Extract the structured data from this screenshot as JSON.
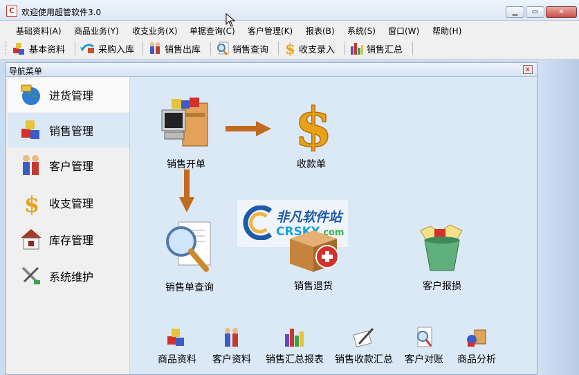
{
  "window": {
    "app_icon_letter": "C",
    "title": "欢迎使用超管软件3.0",
    "controls": [
      "minimize",
      "maximize",
      "close"
    ]
  },
  "menubar": {
    "items": [
      "基础资料(A)",
      "商品业务(Y)",
      "收支业务(X)",
      "单据查询(C)",
      "客户管理(K)",
      "报表(B)",
      "系统(S)",
      "窗口(W)",
      "帮助(H)"
    ]
  },
  "toolbar": {
    "buttons": [
      {
        "label": "基本资料",
        "icon": "blocks-icon"
      },
      {
        "label": "采购入库",
        "icon": "purchase-icon"
      },
      {
        "label": "销售出库",
        "icon": "people-icon"
      },
      {
        "label": "销售查询",
        "icon": "magnifier-doc-icon"
      },
      {
        "label": "收支录入",
        "icon": "dollar-icon"
      },
      {
        "label": "销售汇总",
        "icon": "bar-chart-icon"
      }
    ]
  },
  "panel": {
    "title": "导航菜单",
    "close_label": "x"
  },
  "nav": {
    "items": [
      {
        "label": "进货管理",
        "icon": "globe-icon",
        "state": "hover"
      },
      {
        "label": "销售管理",
        "icon": "blocks-icon",
        "state": "active"
      },
      {
        "label": "客户管理",
        "icon": "people-icon",
        "state": ""
      },
      {
        "label": "收支管理",
        "icon": "dollar-icon",
        "state": ""
      },
      {
        "label": "库存管理",
        "icon": "house-icon",
        "state": ""
      },
      {
        "label": "系统维护",
        "icon": "tools-icon",
        "state": ""
      }
    ]
  },
  "content": {
    "big_items": [
      {
        "label": "销售开单",
        "icon": "pc-boxes-icon"
      },
      {
        "label": "收款单",
        "icon": "dollar-icon"
      },
      {
        "label": "销售单查询",
        "icon": "magnifier-doc-icon"
      },
      {
        "label": "销售退货",
        "icon": "box-return-icon"
      },
      {
        "label": "客户报损",
        "icon": "trash-bin-icon"
      }
    ],
    "small_items": [
      {
        "label": "商品资料",
        "icon": "blocks-icon"
      },
      {
        "label": "客户资料",
        "icon": "people-icon"
      },
      {
        "label": "销售汇总报表",
        "icon": "bar-chart-icon"
      },
      {
        "label": "销售收款汇总",
        "icon": "pen-doc-icon"
      },
      {
        "label": "客户对账",
        "icon": "magnifier-doc-icon"
      },
      {
        "label": "商品分析",
        "icon": "analysis-icon"
      }
    ]
  },
  "watermark": {
    "cn": "非凡软件站",
    "en": "CRSKY",
    "en_suffix": ".com"
  },
  "colors": {
    "panel_bg": "#dbe8f6",
    "nav_bg": "#f0f0f0",
    "accent_blue": "#1d5aa7",
    "dollar_gold": "#e8a21a"
  }
}
